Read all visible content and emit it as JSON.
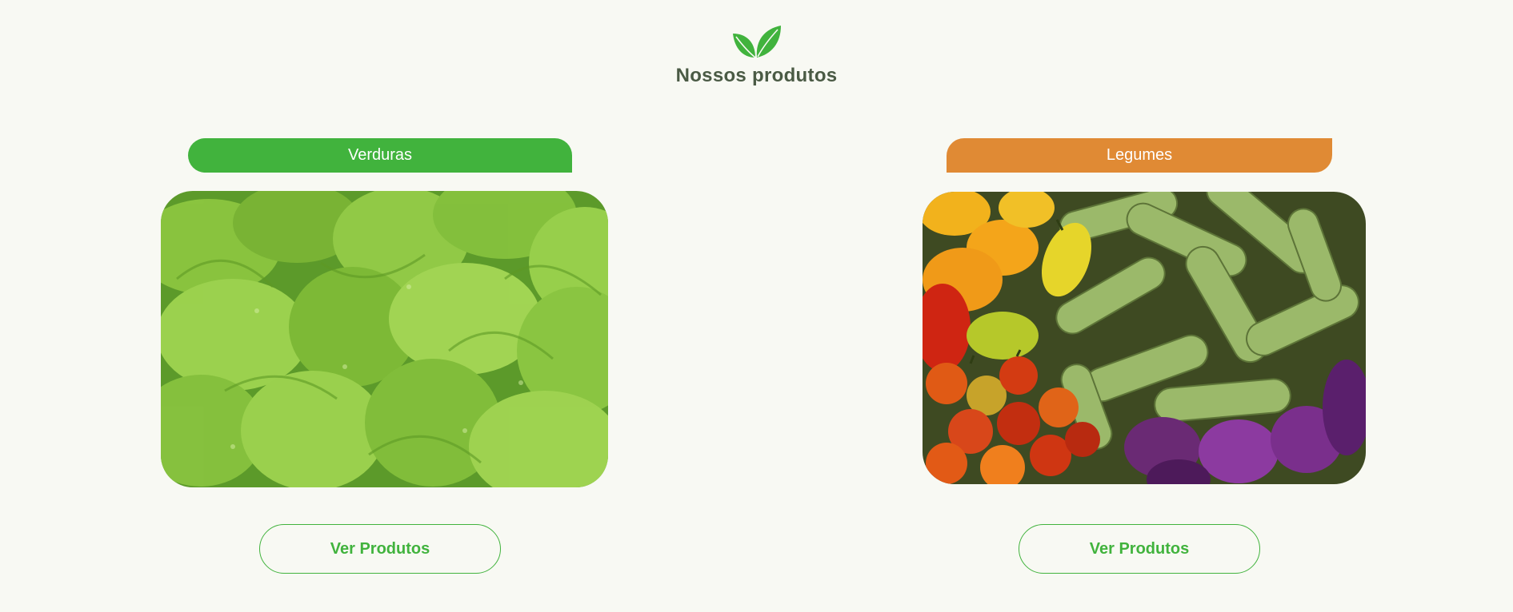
{
  "header": {
    "logo_icon": "leaf-icon",
    "title": "Nossos produtos"
  },
  "categories": [
    {
      "label": "Verduras",
      "color": "#41b33d",
      "image": "lettuce-leaves-photo",
      "button_label": "Ver Produtos"
    },
    {
      "label": "Legumes",
      "color": "#e08a34",
      "image": "vegetables-photo",
      "button_label": "Ver Produtos"
    }
  ],
  "colors": {
    "background": "#f8f9f3",
    "title": "#4a5a44",
    "button_border": "#41b33d"
  }
}
